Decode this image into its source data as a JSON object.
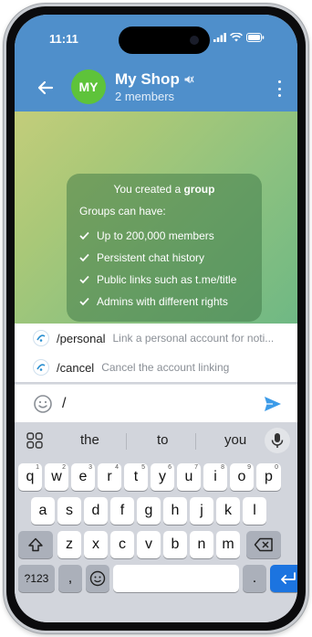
{
  "status": {
    "time": "11:11"
  },
  "header": {
    "title": "My Shop",
    "avatar_initials": "MY",
    "subtitle": "2 members"
  },
  "service_message": {
    "created_prefix": "You created a ",
    "created_bold": "group",
    "intro": "Groups can have:",
    "features": [
      "Up to 200,000 members",
      "Persistent chat history",
      "Public links such as t.me/title",
      "Admins with different rights"
    ]
  },
  "commands": [
    {
      "name": "/personal",
      "description": "Link a personal account for noti..."
    },
    {
      "name": "/cancel",
      "description": "Cancel the account linking"
    }
  ],
  "composer": {
    "value": "/"
  },
  "keyboard": {
    "suggestions": [
      "the",
      "to",
      "you"
    ],
    "row1": [
      "q",
      "w",
      "e",
      "r",
      "t",
      "y",
      "u",
      "i",
      "o",
      "p"
    ],
    "row1_hints": [
      "1",
      "2",
      "3",
      "4",
      "5",
      "6",
      "7",
      "8",
      "9",
      "0"
    ],
    "row2": [
      "a",
      "s",
      "d",
      "f",
      "g",
      "h",
      "j",
      "k",
      "l"
    ],
    "row3": [
      "z",
      "x",
      "c",
      "v",
      "b",
      "n",
      "m"
    ],
    "symbols_label": "?123",
    "comma_label": ",",
    "period_label": "."
  },
  "colors": {
    "header": "#4f8fcb",
    "avatar": "#5ec33a",
    "accent": "#1c74e0"
  }
}
